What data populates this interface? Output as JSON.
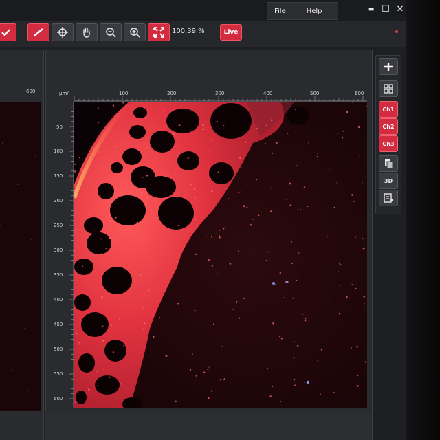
{
  "menu": {
    "file": "File",
    "help": "Help"
  },
  "window_controls": {
    "minimize": "▬",
    "maximize": "☐",
    "close": "✕"
  },
  "toolbar": {
    "zoom_readout": "100.39 %",
    "live_label": "Live",
    "icons": [
      "checkmark-icon",
      "line-tool-icon",
      "crosshair-icon",
      "hand-pan-icon",
      "zoom-out-icon",
      "zoom-in-icon",
      "fit-to-window-icon"
    ]
  },
  "left_panel": {
    "ruler_tick": "600"
  },
  "main_view": {
    "unit": "µm/",
    "x_ticks": [
      "100",
      "200",
      "300",
      "400",
      "500",
      "600"
    ],
    "y_ticks": [
      "50",
      "100",
      "150",
      "200",
      "250",
      "300",
      "350",
      "400",
      "450",
      "500",
      "550",
      "600"
    ]
  },
  "side_tools": {
    "ch1": "Ch1",
    "ch2": "Ch2",
    "ch3": "Ch3",
    "view3d": "3D"
  },
  "colors": {
    "accent": "#d32b3f",
    "fluorescence": "#e23344",
    "background": "#1e1f22"
  }
}
